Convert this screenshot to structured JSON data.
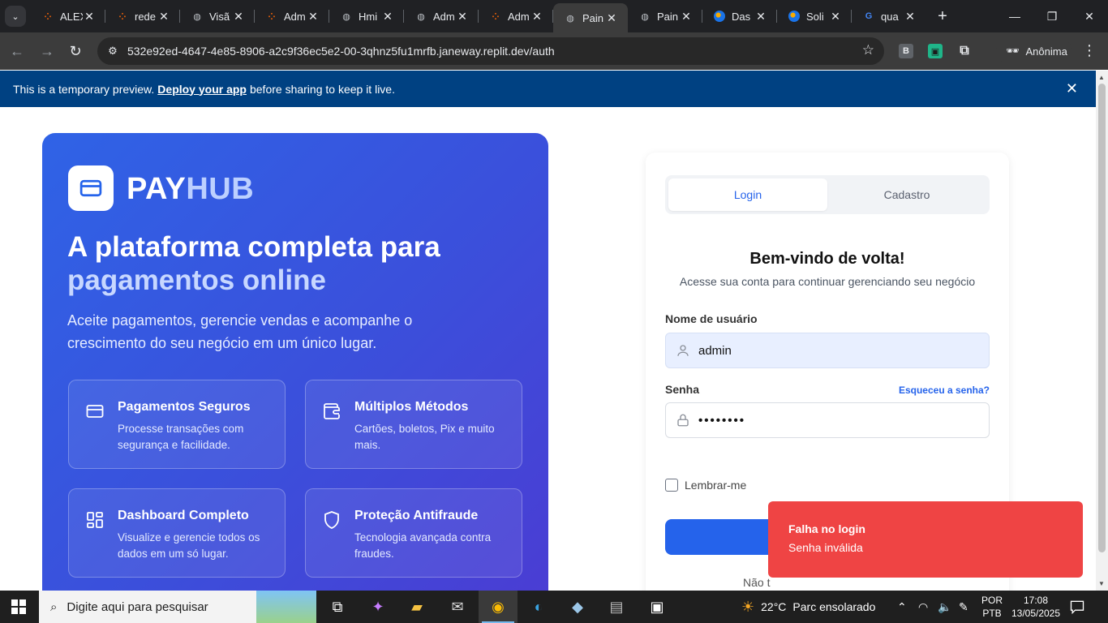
{
  "browser": {
    "tabs": [
      {
        "title": "ALEX",
        "favicon": "replit",
        "active": false
      },
      {
        "title": "rede",
        "favicon": "replit",
        "active": false
      },
      {
        "title": "Visã",
        "favicon": "globe",
        "active": false
      },
      {
        "title": "Adm",
        "favicon": "replit",
        "active": false
      },
      {
        "title": "Hmi",
        "favicon": "globe",
        "active": false
      },
      {
        "title": "Adm",
        "favicon": "globe",
        "active": false
      },
      {
        "title": "Adm",
        "favicon": "replit",
        "active": false
      },
      {
        "title": "Pain",
        "favicon": "globe",
        "active": true
      },
      {
        "title": "Pain",
        "favicon": "globe",
        "active": false
      },
      {
        "title": "Das",
        "favicon": "dash",
        "active": false
      },
      {
        "title": "Soli",
        "favicon": "dash",
        "active": false
      },
      {
        "title": "qua",
        "favicon": "google",
        "active": false
      }
    ],
    "url": "532e92ed-4647-4e85-8906-a2c9f36ec5e2-00-3qhnz5fu1mrfb.janeway.replit.dev/auth",
    "profile_label": "Anônima",
    "extension_b": "B"
  },
  "banner": {
    "text_before": "This is a temporary preview.",
    "link": "Deploy your app",
    "text_after": "before sharing to keep it live."
  },
  "hero": {
    "brand_pay": "PAY",
    "brand_hub": "HUB",
    "title_line1": "A plataforma completa para",
    "title_line2": "pagamentos online",
    "subtitle": "Aceite pagamentos, gerencie vendas e acompanhe o crescimento do seu negócio em um único lugar.",
    "features": [
      {
        "title": "Pagamentos Seguros",
        "desc": "Processe transações com segurança e facilidade.",
        "icon": "card-icon"
      },
      {
        "title": "Múltiplos Métodos",
        "desc": "Cartões, boletos, Pix e muito mais.",
        "icon": "wallet-icon"
      },
      {
        "title": "Dashboard Completo",
        "desc": "Visualize e gerencie todos os dados em um só lugar.",
        "icon": "dashboard-icon"
      },
      {
        "title": "Proteção Antifraude",
        "desc": "Tecnologia avançada contra fraudes.",
        "icon": "shield-icon"
      }
    ]
  },
  "auth": {
    "tab_login": "Login",
    "tab_register": "Cadastro",
    "welcome": "Bem-vindo de volta!",
    "welcome_sub": "Acesse sua conta para continuar gerenciando seu negócio",
    "username_label": "Nome de usuário",
    "username_value": "admin",
    "password_label": "Senha",
    "password_value": "••••••••",
    "forgot": "Esqueceu a senha?",
    "remember": "Lembrar-me",
    "no_account": "Não t"
  },
  "toast": {
    "title": "Falha no login",
    "message": "Senha inválida"
  },
  "taskbar": {
    "search_placeholder": "Digite aqui para pesquisar",
    "weather_temp": "22°C",
    "weather_desc": "Parc ensolarado",
    "lang_line1": "POR",
    "lang_line2": "PTB",
    "time": "17:08",
    "date": "13/05/2025"
  },
  "colors": {
    "primary": "#2563eb",
    "toast_bg": "#ef4444",
    "banner_bg": "#004182"
  }
}
